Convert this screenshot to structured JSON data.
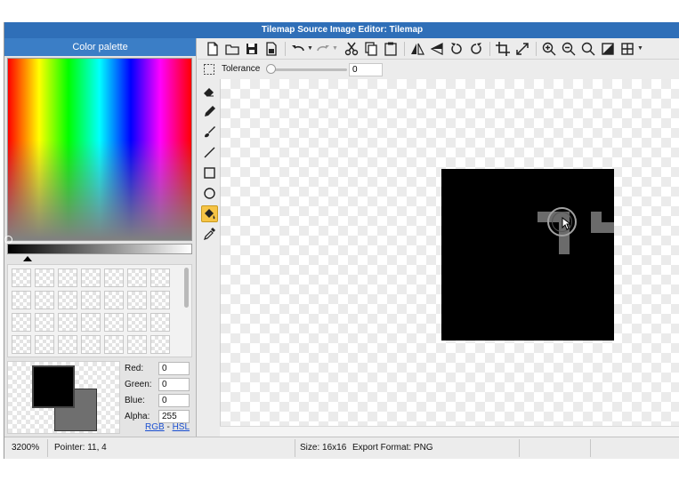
{
  "window": {
    "title": "Tilemap Source Image Editor: Tilemap"
  },
  "palette": {
    "header": "Color palette",
    "labels": {
      "red": "Red:",
      "green": "Green:",
      "blue": "Blue:",
      "alpha": "Alpha:"
    },
    "values": {
      "red": "0",
      "green": "0",
      "blue": "0",
      "alpha": "255"
    },
    "links": {
      "rgb": "RGB",
      "separator": "-",
      "hsl": "HSL"
    },
    "primary_color": "#000000",
    "secondary_color": "#6f6f6f"
  },
  "toolbar": {
    "icons": [
      "new-file-icon",
      "open-folder-icon",
      "save-icon",
      "save-as-icon",
      "undo-icon",
      "redo-icon",
      "cut-icon",
      "copy-icon",
      "paste-icon",
      "flip-horizontal-icon",
      "flip-vertical-icon",
      "rotate-left-icon",
      "rotate-right-icon",
      "crop-icon",
      "resize-icon",
      "zoom-in-icon",
      "zoom-out-icon",
      "zoom-fit-icon",
      "invert-icon",
      "grid-icon"
    ]
  },
  "options": {
    "tolerance_label": "Tolerance",
    "tolerance_value": "0"
  },
  "tools": {
    "items": [
      "eraser-icon",
      "pencil-icon",
      "brush-icon",
      "line-icon",
      "rectangle-icon",
      "ellipse-icon",
      "fill-bucket-icon",
      "eyedropper-icon"
    ],
    "active": "fill-bucket-icon",
    "selection_icon": "selection-icon"
  },
  "status": {
    "zoom": "3200%",
    "pointer": "Pointer: 11, 4",
    "size": "Size: 16x16",
    "format": "Export Format: PNG"
  }
}
